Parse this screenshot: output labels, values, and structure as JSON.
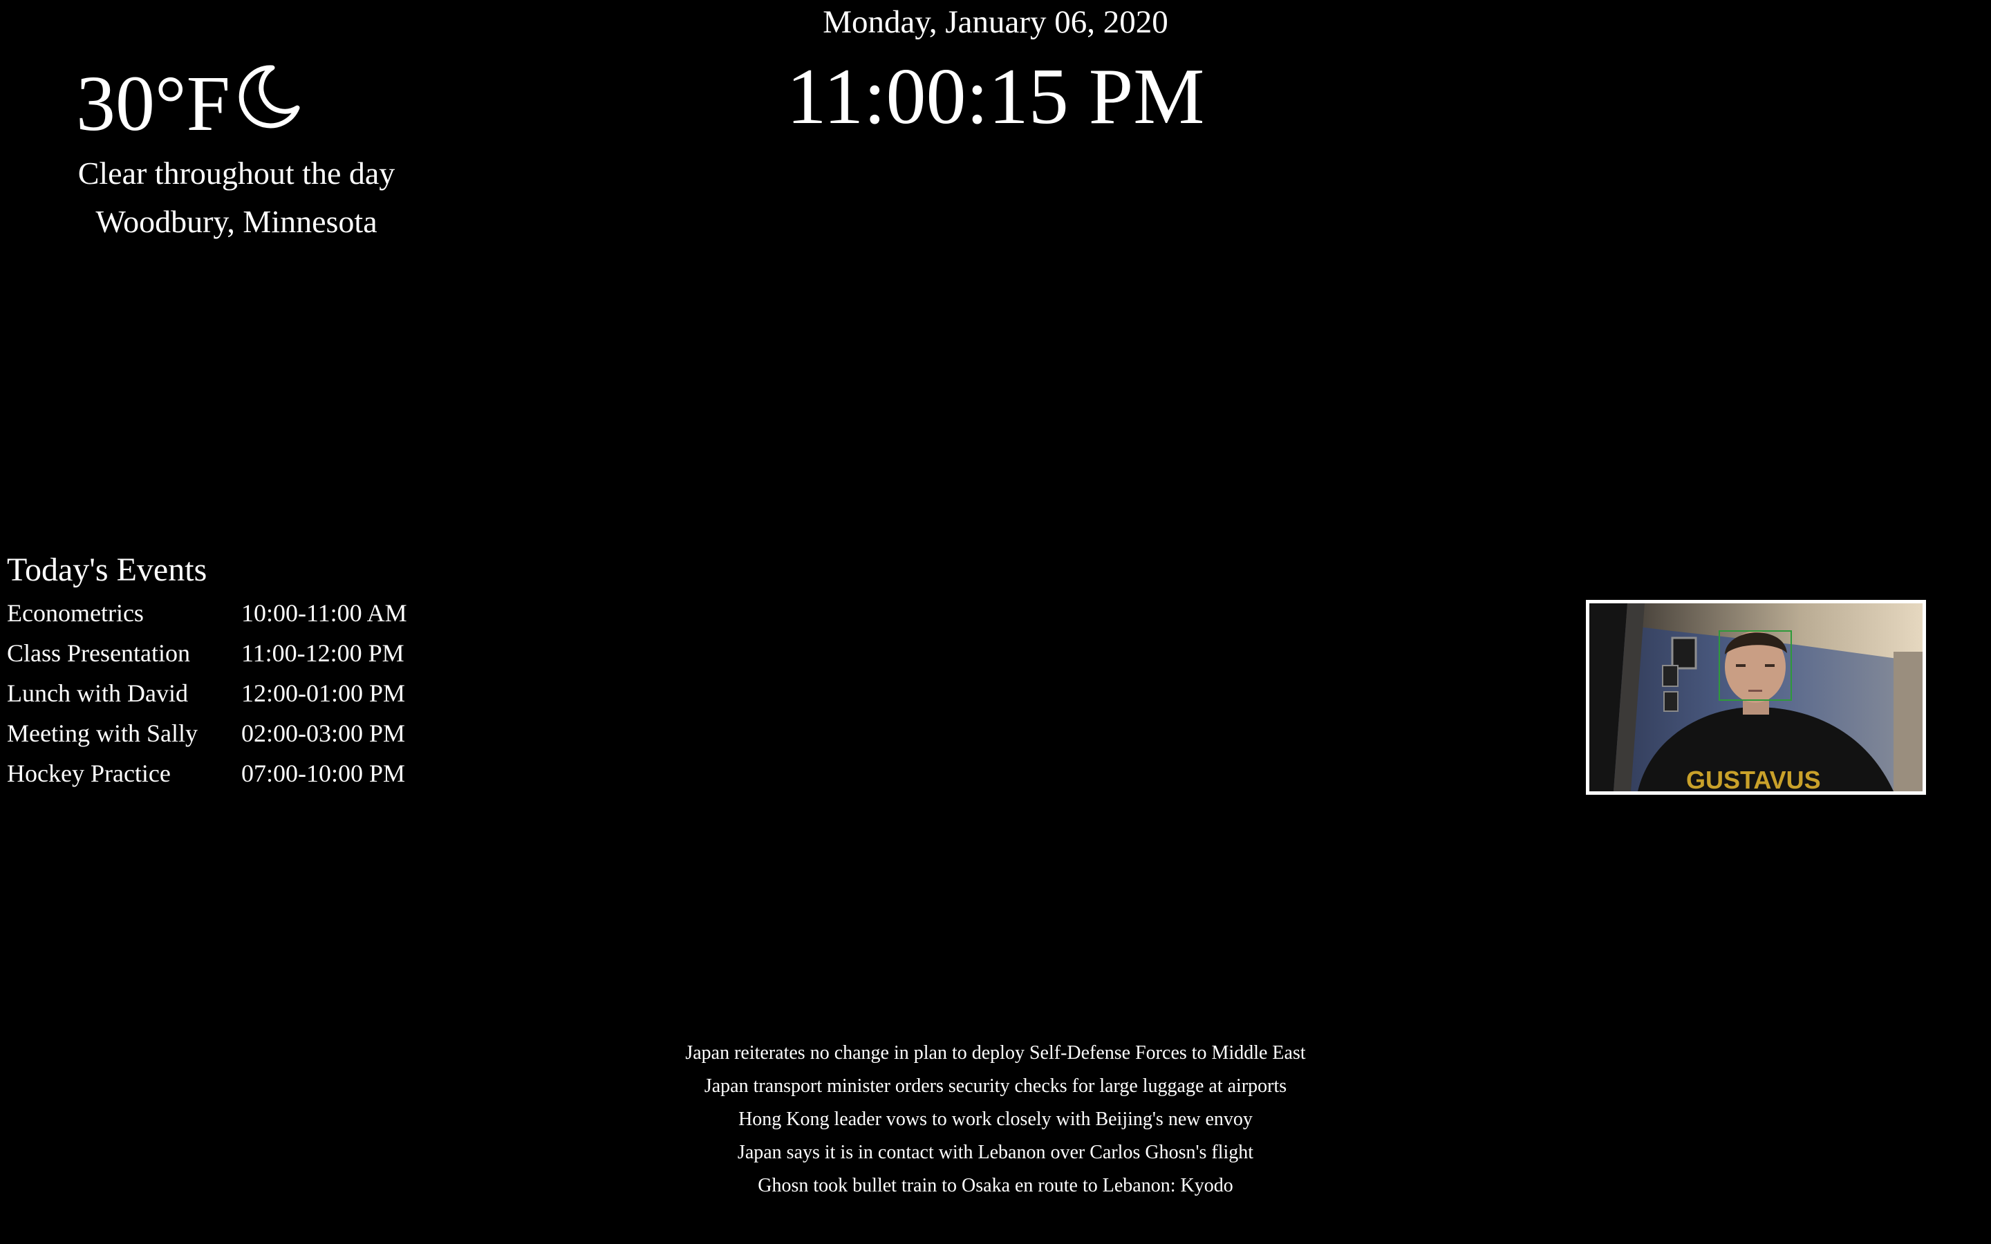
{
  "header": {
    "date": "Monday, January 06, 2020",
    "time": "11:00:15 PM"
  },
  "weather": {
    "temperature": "30°F",
    "icon": "moon-icon",
    "summary": "Clear throughout the day",
    "location": "Woodbury, Minnesota"
  },
  "events": {
    "title": "Today's Events",
    "items": [
      {
        "name": "Econometrics",
        "time": "10:00-11:00 AM"
      },
      {
        "name": "Class Presentation",
        "time": "11:00-12:00 PM"
      },
      {
        "name": "Lunch with David",
        "time": "12:00-01:00 PM"
      },
      {
        "name": "Meeting with Sally",
        "time": "02:00-03:00 PM"
      },
      {
        "name": "Hockey Practice",
        "time": "07:00-10:00 PM"
      }
    ]
  },
  "camera": {
    "shirt_text": "GUSTAVUS",
    "face_box_color": "#2e9a3a"
  },
  "news": {
    "headlines": [
      "Japan reiterates no change in plan to deploy Self-Defense Forces to Middle East",
      "Japan transport minister orders security checks for large luggage at airports",
      "Hong Kong leader vows to work closely with Beijing's new envoy",
      "Japan says it is in contact with Lebanon over Carlos Ghosn's flight",
      "Ghosn took bullet train to Osaka en route to Lebanon: Kyodo"
    ]
  },
  "colors": {
    "background": "#000000",
    "text": "#ffffff"
  }
}
